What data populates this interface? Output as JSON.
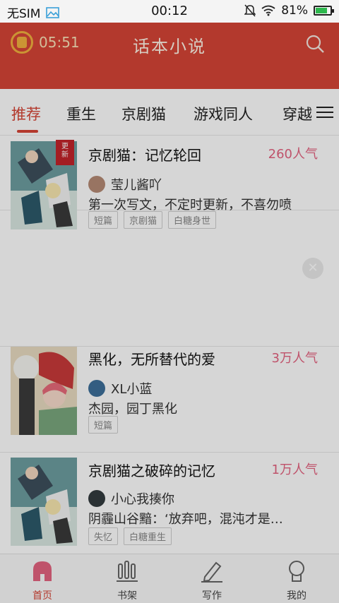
{
  "status_bar": {
    "carrier": "无SIM",
    "time": "00:12",
    "battery": "81%",
    "battery_level": 0.81
  },
  "header": {
    "timer": "05:51",
    "title": "话本小说"
  },
  "tabs": [
    {
      "label": "推荐",
      "active": true
    },
    {
      "label": "重生",
      "active": false
    },
    {
      "label": "京剧猫",
      "active": false
    },
    {
      "label": "游戏同人",
      "active": false
    },
    {
      "label": "穿越",
      "active": false
    }
  ],
  "books": [
    {
      "title": "京剧猫：记忆轮回",
      "popularity": "260人气",
      "author": "莹儿酱吖",
      "description": "第一次写文，不定时更新，不喜勿喷",
      "tags": [
        "短篇",
        "京剧猫",
        "白糖身世"
      ],
      "badge": "更新"
    },
    {
      "title": "黑化，无所替代的爱",
      "popularity": "3万人气",
      "author": "XL小蓝",
      "description": "杰园，园丁黑化",
      "tags": [
        "短篇"
      ]
    },
    {
      "title": "京剧猫之破碎的记忆",
      "popularity": "1万人气",
      "author": "小心我揍你",
      "description": "阴霾山谷黯：‘放弃吧，混沌才是…",
      "tags": [
        "失忆",
        "白糖重生"
      ]
    }
  ],
  "bottom_nav": [
    {
      "label": "首页",
      "icon": "home-icon",
      "active": true
    },
    {
      "label": "书架",
      "icon": "bookshelf-icon",
      "active": false
    },
    {
      "label": "写作",
      "icon": "pen-icon",
      "active": false
    },
    {
      "label": "我的",
      "icon": "profile-icon",
      "active": false
    }
  ],
  "colors": {
    "brand": "#d64536",
    "popularity": "#e46380"
  }
}
